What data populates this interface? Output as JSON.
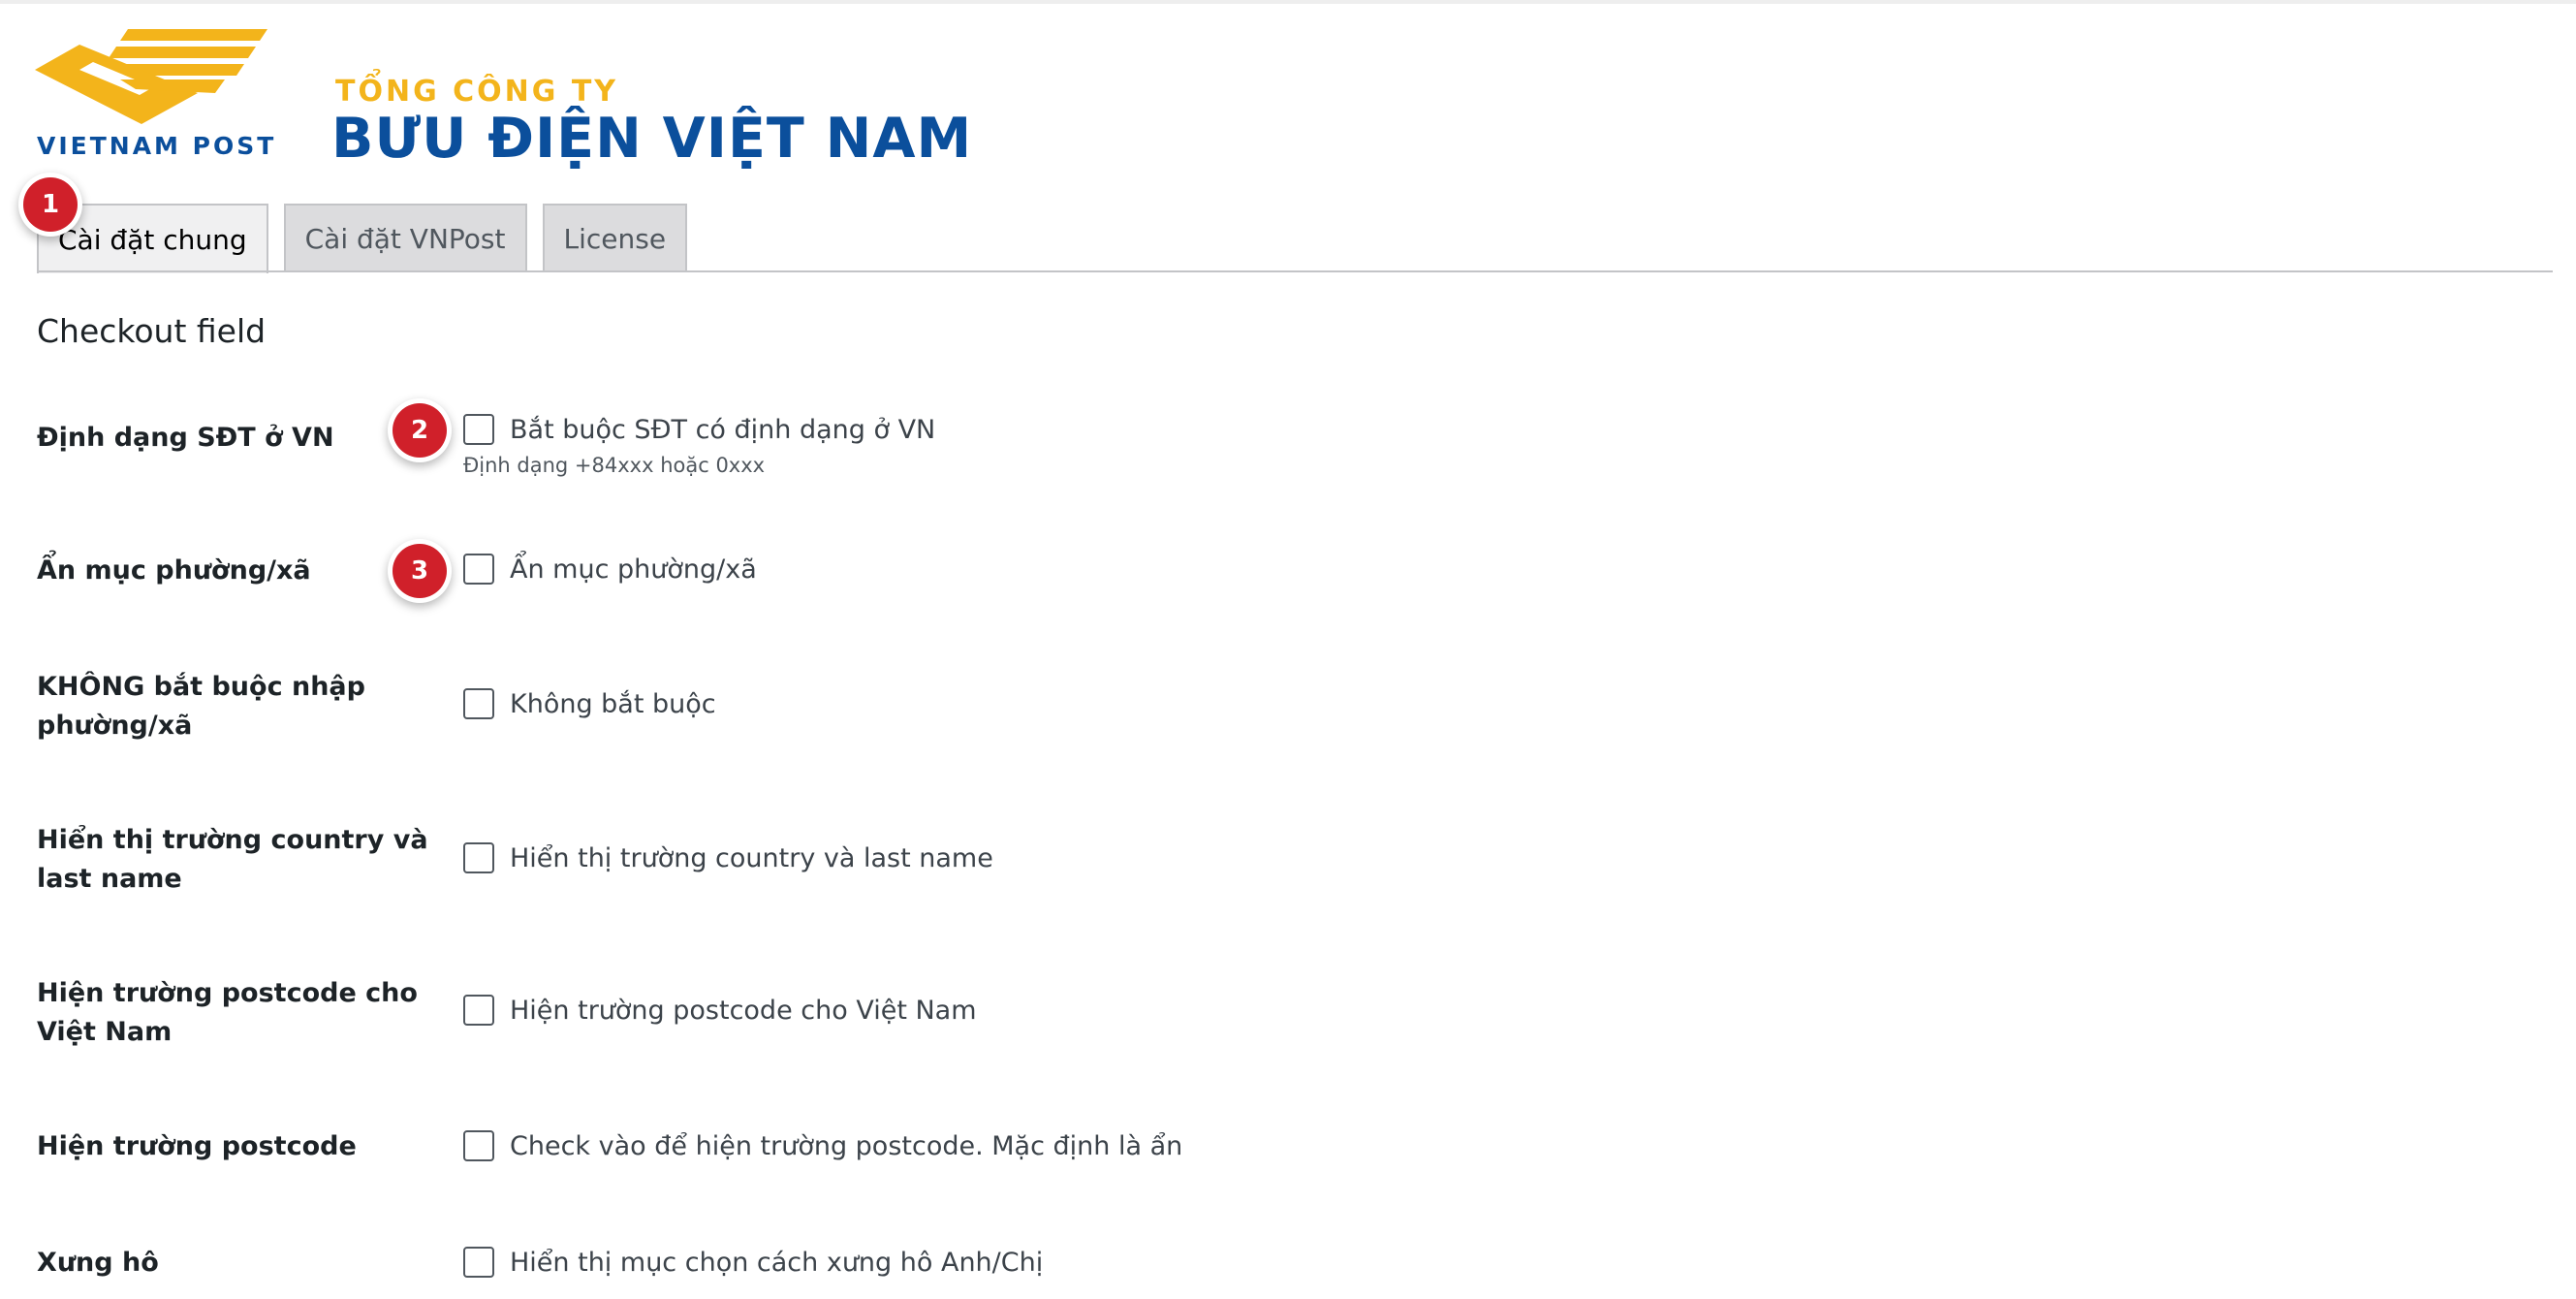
{
  "logo": {
    "brand": "VIETNAM POST",
    "company_line": "TỔNG CÔNG TY",
    "company_name": "BƯU ĐIỆN VIỆT NAM",
    "colors": {
      "blue": "#0b4f9c",
      "yellow": "#f3b41b"
    }
  },
  "tabs": [
    {
      "label": "Cài đặt chung",
      "active": true
    },
    {
      "label": "Cài đặt VNPost",
      "active": false
    },
    {
      "label": "License",
      "active": false
    }
  ],
  "markers": [
    "1",
    "2",
    "3"
  ],
  "section": {
    "title": "Checkout field"
  },
  "fields": [
    {
      "label": "Định dạng SĐT ở VN",
      "checkbox_label": "Bắt buộc SĐT có định dạng ở VN",
      "description": "Định dạng +84xxx hoặc 0xxx",
      "checked": false
    },
    {
      "label": "Ẩn mục phường/xã",
      "checkbox_label": "Ẩn mục phường/xã",
      "checked": false
    },
    {
      "label": "KHÔNG bắt buộc nhập phường/xã",
      "checkbox_label": "Không bắt buộc",
      "checked": false
    },
    {
      "label": "Hiển thị trường country và last name",
      "checkbox_label": "Hiển thị trường country và last name",
      "checked": false
    },
    {
      "label": "Hiện trường postcode cho Việt Nam",
      "checkbox_label": "Hiện trường postcode cho Việt Nam",
      "checked": false
    },
    {
      "label": "Hiện trường postcode",
      "checkbox_label": "Check vào để hiện trường postcode. Mặc định là ẩn",
      "checked": false
    },
    {
      "label": "Xưng hô",
      "checkbox_label": "Hiển thị mục chọn cách xưng hô Anh/Chị",
      "checked": false
    }
  ],
  "colors": {
    "marker": "#d0202a",
    "tab_active_bg": "#f0f0f1",
    "tab_bg": "#dcdcde"
  }
}
